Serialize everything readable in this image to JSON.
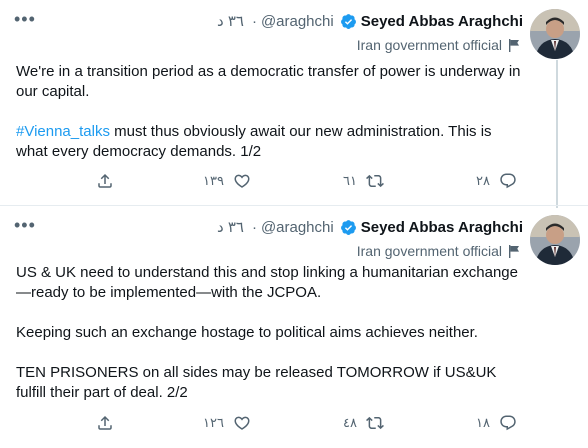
{
  "tweets": [
    {
      "author": {
        "name": "Seyed Abbas Araghchi",
        "handle": "@araghchi",
        "time": "٣٦ د",
        "label": "Iran government official"
      },
      "body": {
        "p1": "We're in a transition period as a democratic transfer of power is underway in our capital.",
        "p2_hashtag": "#Vienna_talks",
        "p2_rest": " must thus obviously await our new administration. This is what every democracy demands. 1/2"
      },
      "actions": {
        "reply": "٢٨",
        "retweet": "٦١",
        "like": "١٣٩"
      }
    },
    {
      "author": {
        "name": "Seyed Abbas Araghchi",
        "handle": "@araghchi",
        "time": "٣٦ د",
        "label": "Iran government official"
      },
      "body": {
        "p1": "US & UK need to understand this and stop linking a humanitarian exchange—ready to be implemented—with the JCPOA.",
        "p2": "Keeping such an exchange hostage to political aims achieves neither.",
        "p3": "TEN PRISONERS on all sides may be released TOMORROW if US&UK fulfill their part of deal. 2/2"
      },
      "actions": {
        "reply": "١٨",
        "retweet": "٤٨",
        "like": "١٢٦"
      }
    }
  ],
  "icons": {
    "more": "more-icon",
    "verified": "verified-badge-icon",
    "flag": "flag-icon",
    "reply": "reply-icon",
    "retweet": "retweet-icon",
    "like": "heart-icon",
    "share": "share-icon"
  },
  "colors": {
    "verified": "#1d9bf0",
    "hashtag": "#1d9bf0",
    "muted": "#536471"
  }
}
